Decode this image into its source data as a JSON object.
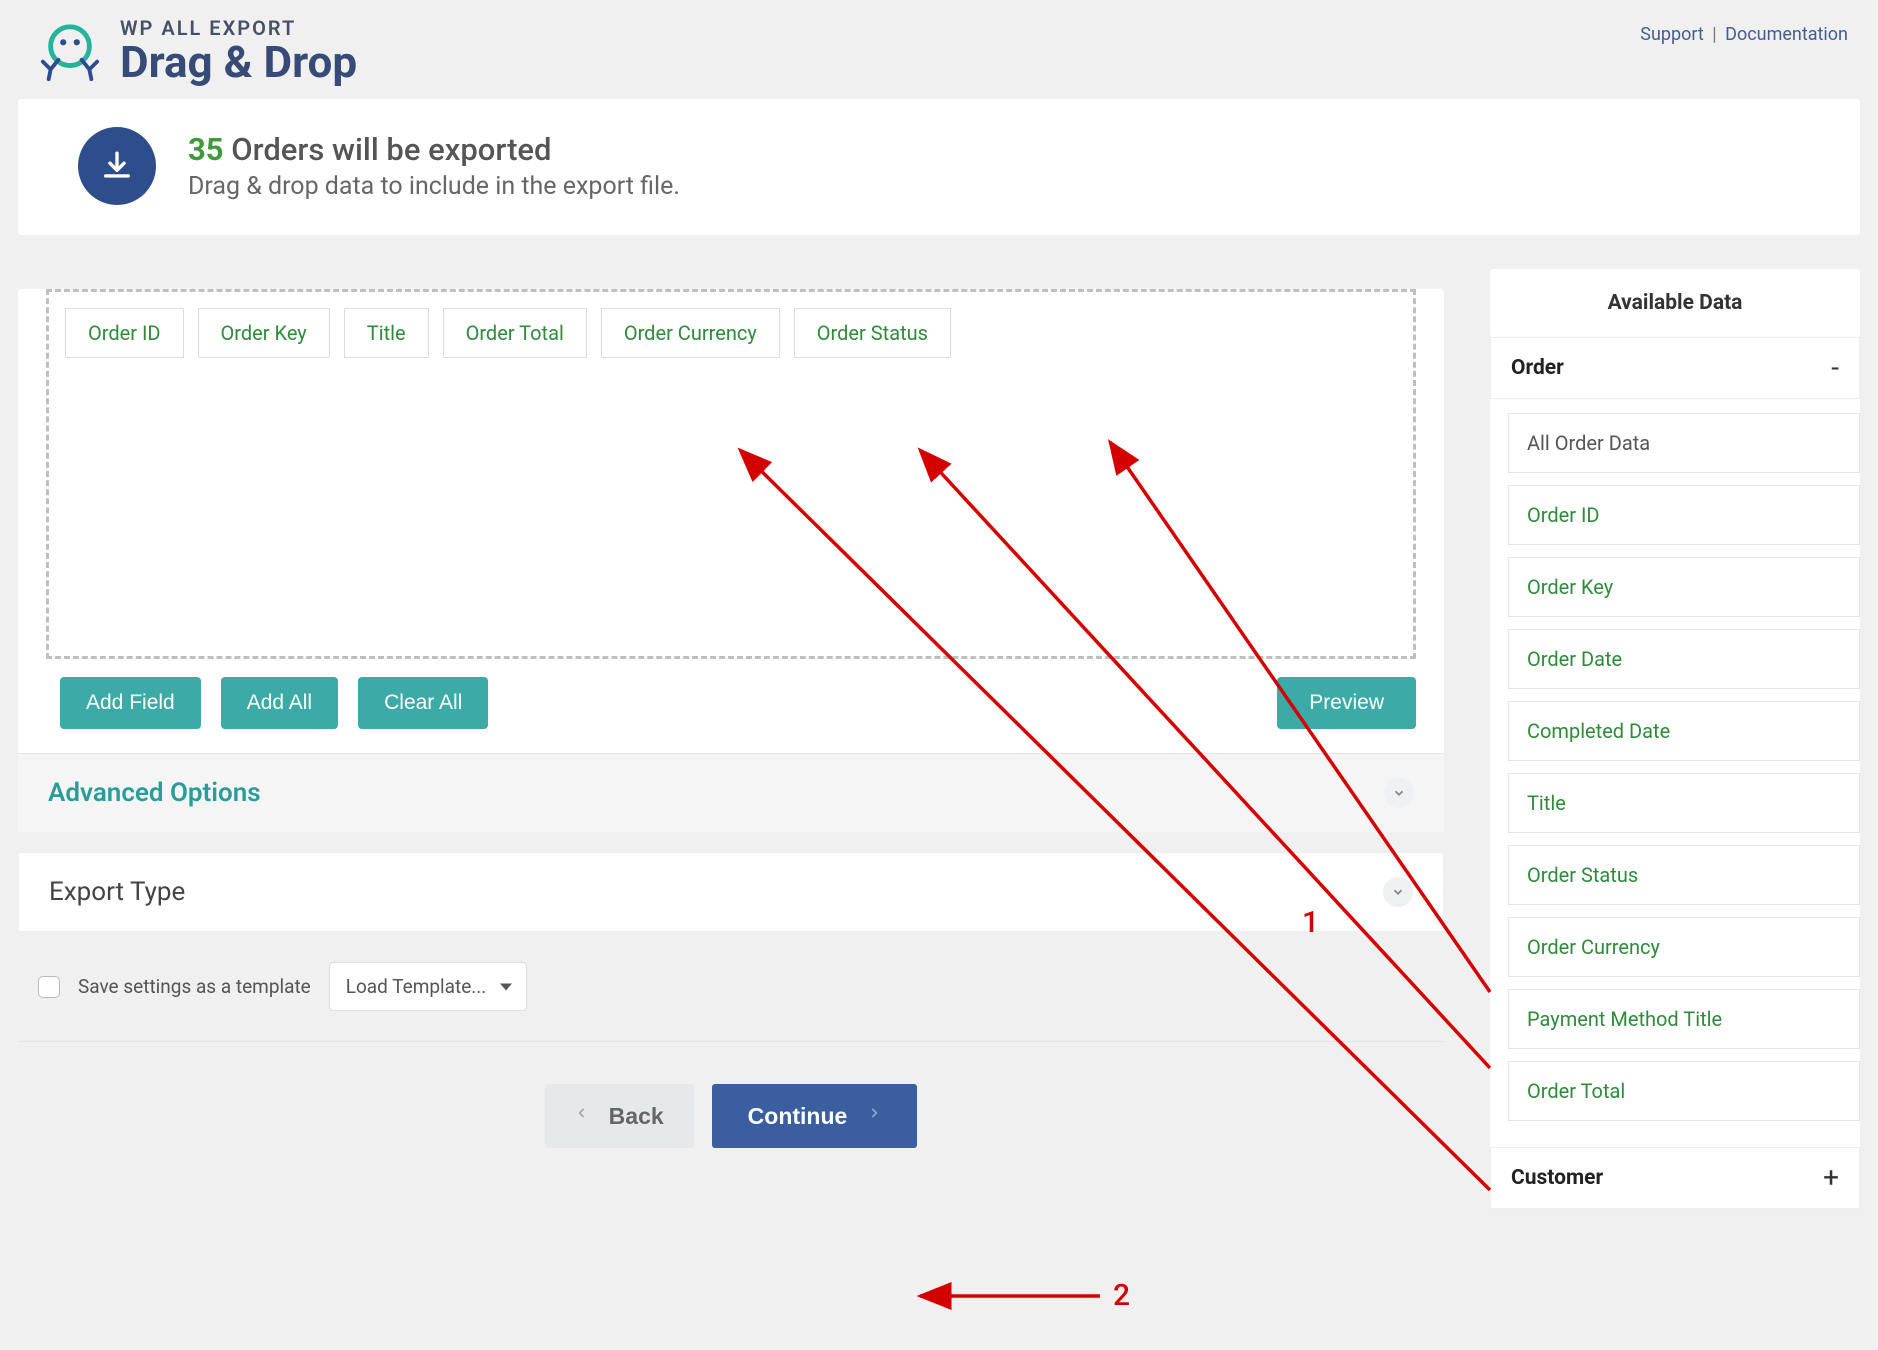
{
  "brand": {
    "sub": "WP ALL EXPORT",
    "main": "Drag & Drop"
  },
  "toplinks": {
    "support": "Support",
    "docs": "Documentation"
  },
  "hero": {
    "count": "35",
    "title_rest": "Orders will be exported",
    "subtitle": "Drag & drop data to include in the export file."
  },
  "dropzone": {
    "chips": [
      "Order ID",
      "Order Key",
      "Title",
      "Order Total",
      "Order Currency",
      "Order Status"
    ]
  },
  "buttons": {
    "add_field": "Add Field",
    "add_all": "Add All",
    "clear_all": "Clear All",
    "preview": "Preview"
  },
  "sections": {
    "advanced": "Advanced Options",
    "export_type": "Export Type"
  },
  "template": {
    "checkbox_label": "Save settings as a template",
    "select_label": "Load Template..."
  },
  "nav": {
    "back": "Back",
    "continue": "Continue"
  },
  "sidebar": {
    "head": "Available Data",
    "groups": [
      {
        "title": "Order",
        "expanded": true,
        "toggle": "-",
        "items": [
          {
            "label": "All Order Data",
            "gray": true
          },
          {
            "label": "Order ID"
          },
          {
            "label": "Order Key"
          },
          {
            "label": "Order Date"
          },
          {
            "label": "Completed Date"
          },
          {
            "label": "Title"
          },
          {
            "label": "Order Status"
          },
          {
            "label": "Order Currency"
          },
          {
            "label": "Payment Method Title"
          },
          {
            "label": "Order Total"
          }
        ]
      },
      {
        "title": "Customer",
        "expanded": false,
        "toggle": "+",
        "items": []
      }
    ]
  },
  "annotations": {
    "one": "1",
    "two": "2"
  }
}
